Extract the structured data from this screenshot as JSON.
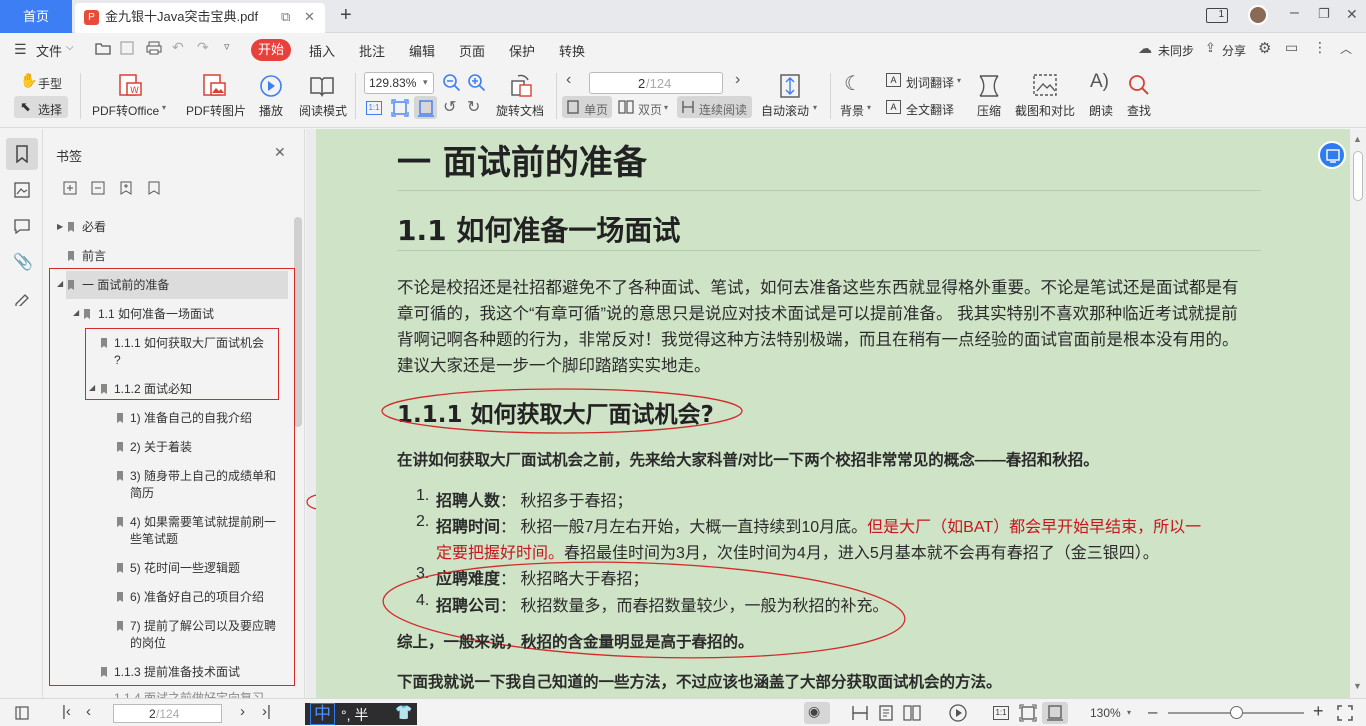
{
  "tabs": {
    "home": "首页",
    "document": "金九银十Java突击宝典.pdf",
    "badge": "1"
  },
  "menu": {
    "file": "文件",
    "items": [
      "开始",
      "插入",
      "批注",
      "编辑",
      "页面",
      "保护",
      "转换"
    ],
    "sync": "未同步",
    "share": "分享"
  },
  "toolbar": {
    "hand": "手型",
    "select": "选择",
    "pdf_to_office": "PDF转Office",
    "pdf_to_image": "PDF转图片",
    "play": "播放",
    "read_mode": "阅读模式",
    "zoom": "129.83%",
    "rotate_doc": "旋转文档",
    "page_current": "2",
    "page_total": "/124",
    "single": "单页",
    "double": "双页",
    "continuous": "连续阅读",
    "auto_scroll": "自动滚动",
    "background": "背景",
    "word_translate": "划词翻译",
    "full_translate": "全文翻译",
    "compress": "压缩",
    "screenshot_compare": "截图和对比",
    "read_aloud": "朗读",
    "find": "查找"
  },
  "bookmarks": {
    "title": "书签",
    "items": [
      {
        "label": "必看"
      },
      {
        "label": "前言"
      },
      {
        "label": "一 面试前的准备"
      },
      {
        "label": "1.1 如何准备一场面试"
      },
      {
        "label": "1.1.1   如何获取大厂面试机会",
        "label2": "?"
      },
      {
        "label": "1.1.2   面试必知"
      },
      {
        "label": "1) 准备自己的自我介绍"
      },
      {
        "label": "2) 关于着装"
      },
      {
        "label": "3) 随身带上自己的成绩单和",
        "label2": "简历"
      },
      {
        "label": "4) 如果需要笔试就提前刷一",
        "label2": "些笔试题"
      },
      {
        "label": "5) 花时间一些逻辑题"
      },
      {
        "label": "6) 准备好自己的项目介绍"
      },
      {
        "label": "7) 提前了解公司以及要应聘",
        "label2": "的岗位"
      },
      {
        "label": "1.1.3 提前准备技术面试"
      },
      {
        "label": "1.1.4 面试之前做好定向复习"
      }
    ]
  },
  "page": {
    "h1": "一 面试前的准备",
    "h2": "1.1 如何准备一场面试",
    "para": [
      "不论是校招还是社招都避免不了各种面试、笔试，如何去准备这些东西就显得格外重要。不论是笔试还是面试都是有",
      "章可循的，我这个“有章可循”说的意思只是说应对技术面试是可以提前准备。 我其实特别不喜欢那种临近考试就提前",
      "背啊记啊各种题的行为，非常反对！我觉得这种方法特别极端，而且在稍有一点经验的面试官面前是根本没有用的。",
      "建议大家还是一步一个脚印踏踏实实地走。"
    ],
    "h3": "1.1.1 如何获取大厂面试机会?",
    "intro": "在讲如何获取大厂面试机会之前，先来给大家科普/对比一下两个校招非常常见的概念——春招和秋招。",
    "list": [
      {
        "num": "1.",
        "bold": "招聘人数",
        "text": "： 秋招多于春招；"
      },
      {
        "num": "2.",
        "bold": "招聘时间",
        "text": "：  秋招一般7月左右开始，大概一直持续到10月底。",
        "red": "但是大厂（如BAT）都会早开始早结束，所以一",
        "red2": "定要把握好时间。",
        "text2": "春招最佳时间为3月，次佳时间为4月，进入5月基本就不会再有春招了（金三银四）。"
      },
      {
        "num": "3.",
        "bold": "应聘难度",
        "text": "： 秋招略大于春招；"
      },
      {
        "num": "4.",
        "bold": "招聘公司",
        "text": "：  秋招数量多，而春招数量较少，一般为秋招的补充。"
      }
    ],
    "summary": "综上，一般来说，秋招的含金量明显是高于春招的。",
    "next": "下面我就说一下我自己知道的一些方法，不过应该也涵盖了大部分获取面试机会的方法。"
  },
  "status": {
    "page_current": "2",
    "page_total": "/124",
    "ime": "中",
    "ime_extra": "°, 半",
    "zoom": "130%"
  },
  "colors": {
    "accent": "#3e7ef4",
    "start_red": "#e8403a",
    "page_bg": "#cfe3c7",
    "annotation": "#d42a2a"
  }
}
